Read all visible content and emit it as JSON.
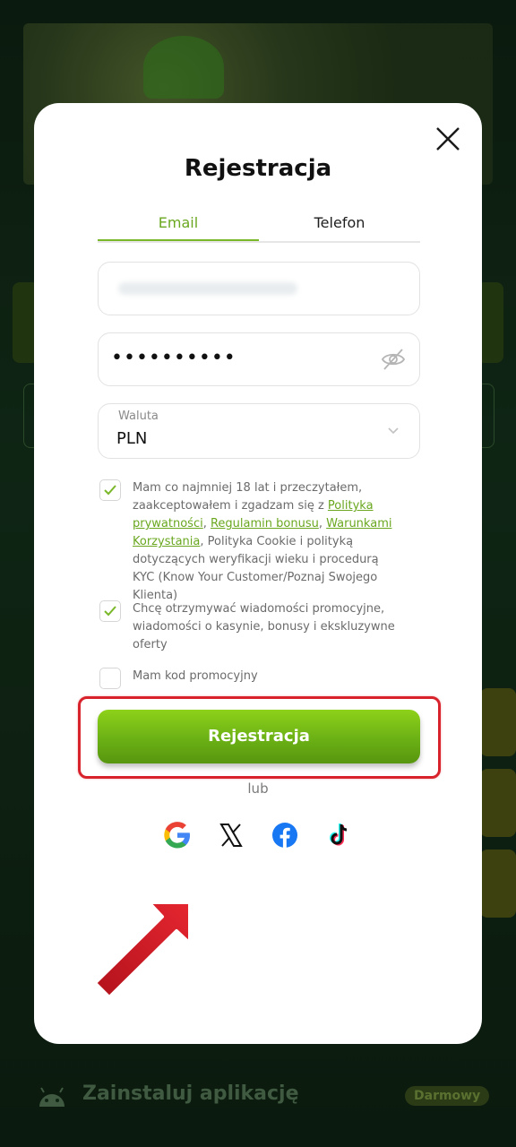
{
  "background": {
    "install_text": "Zainstaluj aplikację",
    "free_badge": "Darmowy"
  },
  "modal": {
    "title": "Rejestracja",
    "tabs": [
      {
        "label": "Email",
        "active": true
      },
      {
        "label": "Telefon",
        "active": false
      }
    ],
    "password": {
      "value": "••••••••••"
    },
    "currency": {
      "label": "Waluta",
      "value": "PLN"
    },
    "consents": [
      {
        "checked": true,
        "text_1": "Mam co najmniej 18 lat i przeczytałem, zaakceptowałem i zgadzam się z ",
        "link_privacy": "Polityka prywatności",
        "sep_1": ", ",
        "link_bonus": "Regulamin bonusu",
        "sep_2": ", ",
        "link_terms": "Warunkami Korzystania",
        "text_2": ", Polityka Cookie i polityką dotyczących weryfikacji wieku i procedurą KYC (Know Your Customer/Poznaj Swojego Klienta)"
      },
      {
        "checked": true,
        "text": "Chcę otrzymywać wiadomości promocyjne, wiadomości o kasynie, bonusy i ekskluzywne oferty"
      },
      {
        "checked": false,
        "text": "Mam kod promocyjny"
      }
    ],
    "register_button": "Rejestracja",
    "or_text": "lub",
    "social": [
      "google-icon",
      "x-icon",
      "facebook-icon",
      "tiktok-icon"
    ]
  },
  "colors": {
    "accent": "#7ab82a",
    "button": "#6bb115",
    "highlight": "#d8222c",
    "link": "#6aa71f"
  }
}
